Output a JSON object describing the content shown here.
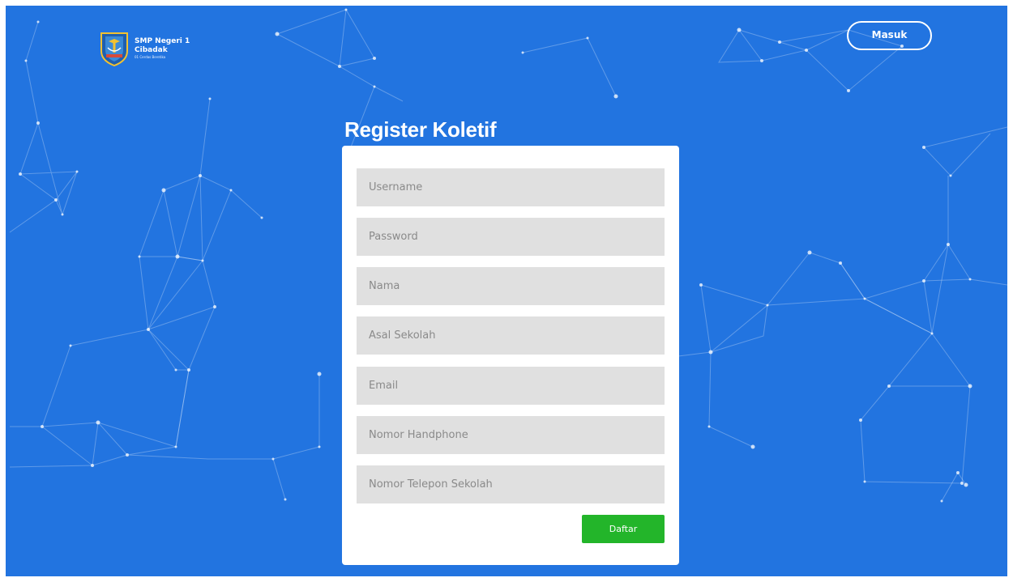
{
  "brand": {
    "name_line1": "SMP Negeri 1",
    "name_line2": "Cibadak",
    "slogan": "01 Cerdas Beretika"
  },
  "header": {
    "login_label": "Masuk"
  },
  "page": {
    "title": "Register Koletif"
  },
  "form": {
    "fields": [
      {
        "name": "username-input",
        "placeholder": "Username",
        "type": "text"
      },
      {
        "name": "password-input",
        "placeholder": "Password",
        "type": "password"
      },
      {
        "name": "nama-input",
        "placeholder": "Nama",
        "type": "text"
      },
      {
        "name": "asal-sekolah-input",
        "placeholder": "Asal Sekolah",
        "type": "text"
      },
      {
        "name": "email-input",
        "placeholder": "Email",
        "type": "email"
      },
      {
        "name": "nomor-handphone-input",
        "placeholder": "Nomor Handphone",
        "type": "tel"
      },
      {
        "name": "nomor-telepon-sekolah-input",
        "placeholder": "Nomor Telepon Sekolah",
        "type": "tel"
      }
    ],
    "submit_label": "Daftar"
  },
  "colors": {
    "background": "#2274e0",
    "card": "#ffffff",
    "input_background": "#e0e0e0",
    "submit": "#23b52a"
  },
  "icons": {
    "logo": "school-shield-emblem"
  }
}
